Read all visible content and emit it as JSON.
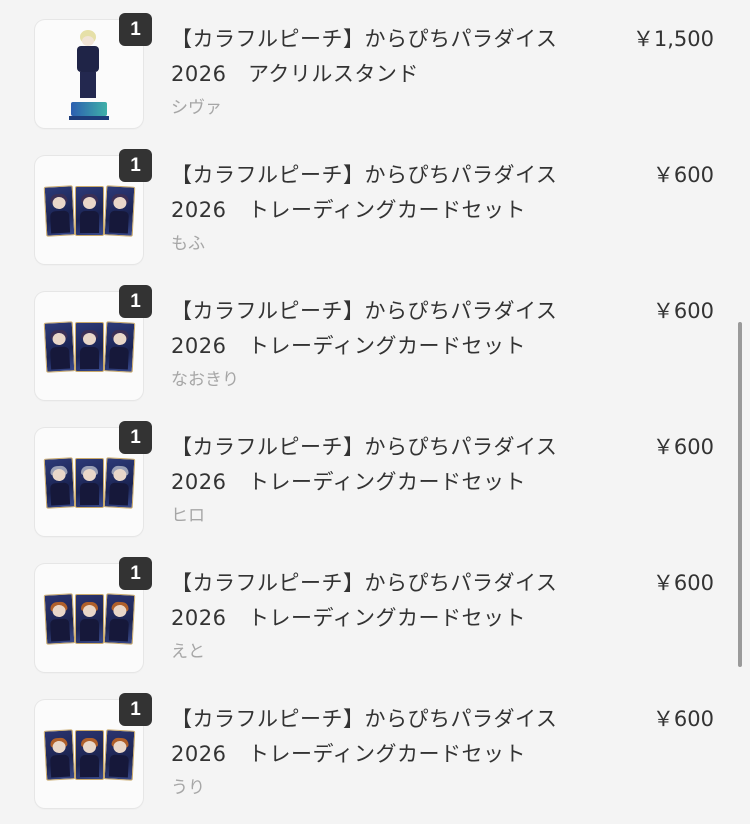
{
  "items": [
    {
      "quantity": "1",
      "title_line1": "【カラフルピーチ】からぴちパラダイス",
      "title_line2": "2026　アクリルスタンド",
      "variant": "シヴァ",
      "price": "￥1,500",
      "thumbnail_icon": "acrylic-stand-image"
    },
    {
      "quantity": "1",
      "title_line1": "【カラフルピーチ】からぴちパラダイス",
      "title_line2": "2026　トレーディングカードセット",
      "variant": "もふ",
      "price": "￥600",
      "thumbnail_icon": "trading-card-set-image"
    },
    {
      "quantity": "1",
      "title_line1": "【カラフルピーチ】からぴちパラダイス",
      "title_line2": "2026　トレーディングカードセット",
      "variant": "なおきり",
      "price": "￥600",
      "thumbnail_icon": "trading-card-set-image"
    },
    {
      "quantity": "1",
      "title_line1": "【カラフルピーチ】からぴちパラダイス",
      "title_line2": "2026　トレーディングカードセット",
      "variant": "ヒロ",
      "price": "￥600",
      "thumbnail_icon": "trading-card-set-image"
    },
    {
      "quantity": "1",
      "title_line1": "【カラフルピーチ】からぴちパラダイス",
      "title_line2": "2026　トレーディングカードセット",
      "variant": "えと",
      "price": "￥600",
      "thumbnail_icon": "trading-card-set-image"
    },
    {
      "quantity": "1",
      "title_line1": "【カラフルピーチ】からぴちパラダイス",
      "title_line2": "2026　トレーディングカードセット",
      "variant": "うり",
      "price": "￥600",
      "thumbnail_icon": "trading-card-set-image"
    }
  ],
  "colors": {
    "background": "#f4f4f4",
    "text": "#333333",
    "muted": "#a6a6a6",
    "badge": "#333333"
  }
}
